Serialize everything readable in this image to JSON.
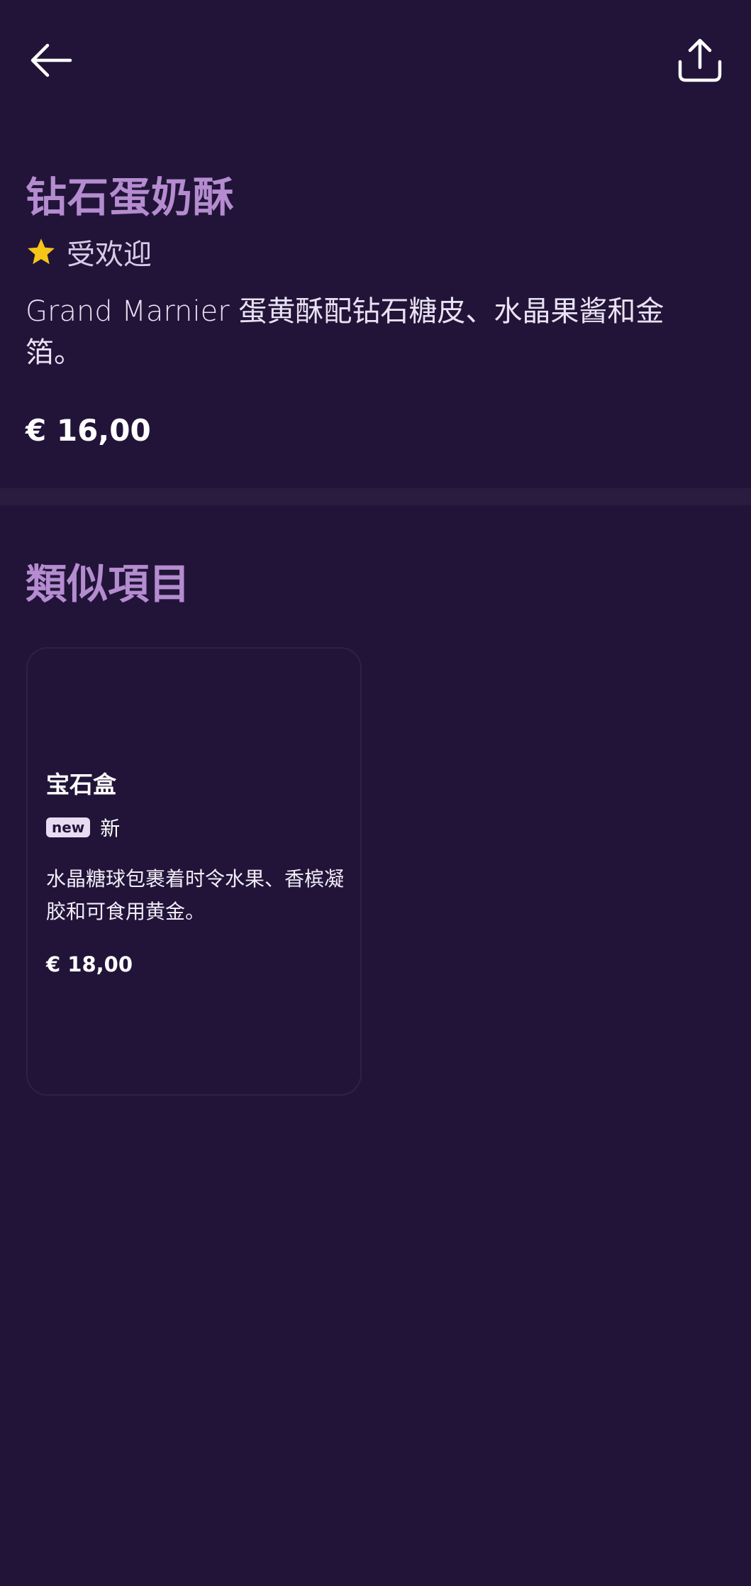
{
  "header": {
    "back_icon": "arrow-left-icon",
    "share_icon": "share-upload-icon"
  },
  "item": {
    "title": "钻石蛋奶酥",
    "tag_icon": "star-icon",
    "tag_label": "受欢迎",
    "description": "Grand Marnier 蛋黄酥配钻石糖皮、水晶果酱和金箔。",
    "price": "€ 16,00"
  },
  "similar": {
    "title": "類似項目",
    "items": [
      {
        "title": "宝石盒",
        "badge": "new",
        "badge_label": "新",
        "description": "水晶糖球包裹着时令水果、香槟凝胶和可食用黄金。",
        "price": "€ 18,00"
      }
    ]
  },
  "colors": {
    "background": "#211438",
    "accent": "#b48ccf",
    "star": "#f5c518"
  }
}
